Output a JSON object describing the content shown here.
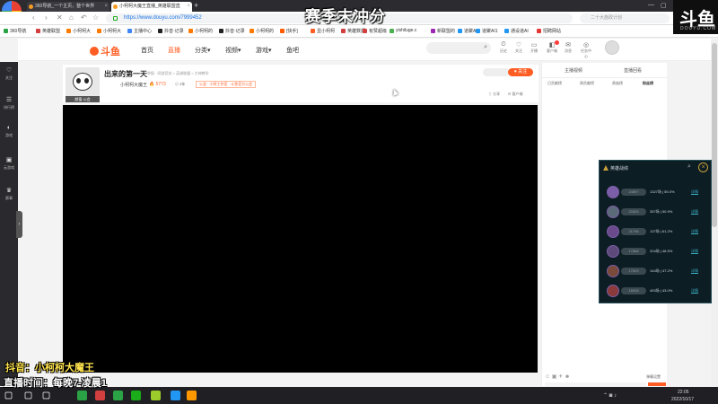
{
  "browser": {
    "logo_label": "360浏览器",
    "tabs": [
      {
        "label": "360导航_一个主页，整个世界",
        "active": false
      },
      {
        "label": "小柯柯大魔王直播_英雄联盟直",
        "active": true
      }
    ],
    "new_tab": "+",
    "url": "https://www.douyu.com/7999452",
    "search_placeholder": "二十大施政计划",
    "bookmarks": [
      {
        "label": "360导航",
        "color": "#2ba245"
      },
      {
        "label": "英雄联盟",
        "color": "#d23f3f"
      },
      {
        "label": "小柯柯大",
        "color": "#ff7a00"
      },
      {
        "label": "小柯柯大",
        "color": "#ff7a00"
      },
      {
        "label": "主播中心",
        "color": "#4285f4"
      },
      {
        "label": "抖音·记录",
        "color": "#222222"
      },
      {
        "label": "小柯柯的",
        "color": "#ff7a00"
      },
      {
        "label": "抖音·记录",
        "color": "#222222"
      },
      {
        "label": "小柯柯的",
        "color": "#ff7a00"
      },
      {
        "label": "[快手]",
        "color": "#ff5a00"
      },
      {
        "label": "显小柯柯",
        "color": "#ff5d23"
      },
      {
        "label": "英雄数据",
        "color": "#d23f3f"
      },
      {
        "label": "有赞超级",
        "color": "#d23f3f"
      },
      {
        "label": "yishiluge.c",
        "color": "#4caf50"
      },
      {
        "label": "新联盟的",
        "color": "#9c27b0"
      },
      {
        "label": "道聚AI1",
        "color": "#2196f3"
      },
      {
        "label": "道聚AI1",
        "color": "#2196f3"
      },
      {
        "label": "通设道AI",
        "color": "#2196f3"
      },
      {
        "label": "招聘网站",
        "color": "#e53935"
      }
    ]
  },
  "overlay": {
    "stream_title": "赛季末冲分",
    "corner_logo": "斗鱼",
    "corner_sub": "DOUYU.COM",
    "line1": "抖音：小柯柯大魔王",
    "line2": "直播时间：每晚7-凌晨1"
  },
  "rail": {
    "items": [
      {
        "icon": "♡",
        "label": "关注"
      },
      {
        "icon": "☰",
        "label": "排行榜"
      },
      {
        "icon": "◐",
        "label": "游戏"
      },
      {
        "icon": "▣",
        "label": "云游戏"
      },
      {
        "icon": "♛",
        "label": "赛事"
      }
    ],
    "collapse_arrow": "›"
  },
  "site": {
    "logo": "斗鱼",
    "nav": [
      "首页",
      "直播",
      "分类▾",
      "视频▾",
      "游戏▾",
      "鱼吧"
    ],
    "header_icons": [
      {
        "icon": "⏲",
        "label": "历史"
      },
      {
        "icon": "♡",
        "label": "关注"
      },
      {
        "icon": "▭",
        "label": "开播"
      },
      {
        "icon": "◧",
        "label": "客户端"
      },
      {
        "icon": "✉",
        "label": "消息"
      },
      {
        "icon": "◎",
        "label": "任务中心"
      }
    ]
  },
  "room": {
    "avatar_tag": "颜值·公会",
    "title": "出来的第一天",
    "category": "举报 · 网游竞技 > 英雄联盟 > 大神教学",
    "anchor_name": "小柯柯大魔王",
    "hot": "🔥 5773",
    "level": "⊙ 3年",
    "guild": "公会 · 小柯工作室 · 斗鱼官方公会",
    "follow_label": "♥ 关注",
    "actions": [
      "⇧ 分享",
      "⊡ 客户端"
    ]
  },
  "chat": {
    "head_tabs": [
      "主播视频",
      "直播回看"
    ],
    "rank_tabs": [
      "日贡献榜",
      "周贡献榜",
      "贵族榜",
      "粉丝榜"
    ],
    "tools": "☺ ▣ ✈ ☻",
    "input_hint": "弹幕设置"
  },
  "hero_panel": {
    "title": "英雄战绩",
    "rows": [
      {
        "pill": "24897",
        "stat": "1327场 | 55.0%",
        "link": "详情",
        "color": "#7b5ea8"
      },
      {
        "pill": "22826",
        "stat": "357场 | 50.9%",
        "link": "详情",
        "color": "#5a6a78"
      },
      {
        "pill": "21796",
        "stat": "137场 | 61.2%",
        "link": "详情",
        "color": "#6a4a8a"
      },
      {
        "pill": "17868",
        "stat": "204场 | 46.5%",
        "link": "详情",
        "color": "#5e4a7a"
      },
      {
        "pill": "17629",
        "stat": "144场 | 47.2%",
        "link": "详情",
        "color": "#7a4a3a"
      },
      {
        "pill": "16928",
        "stat": "493场 | 43.0%",
        "link": "详情",
        "color": "#8a3a3a"
      }
    ]
  },
  "taskbar": {
    "time": "22:05",
    "date": "2022/10/17",
    "apps": [
      {
        "name": "start",
        "color": "#ffffff"
      },
      {
        "name": "search",
        "color": "#ffffff"
      },
      {
        "name": "taskview",
        "color": "#ffffff"
      },
      {
        "name": "browser-360",
        "color": "#2ba245"
      },
      {
        "name": "app-red",
        "color": "#d23f3f"
      },
      {
        "name": "app-green",
        "color": "#2ba245"
      },
      {
        "name": "wechat",
        "color": "#1aad19"
      },
      {
        "name": "app-lime",
        "color": "#9ccc2c"
      },
      {
        "name": "app-blue",
        "color": "#2196f3"
      },
      {
        "name": "app-orange",
        "color": "#ff9800"
      }
    ]
  }
}
